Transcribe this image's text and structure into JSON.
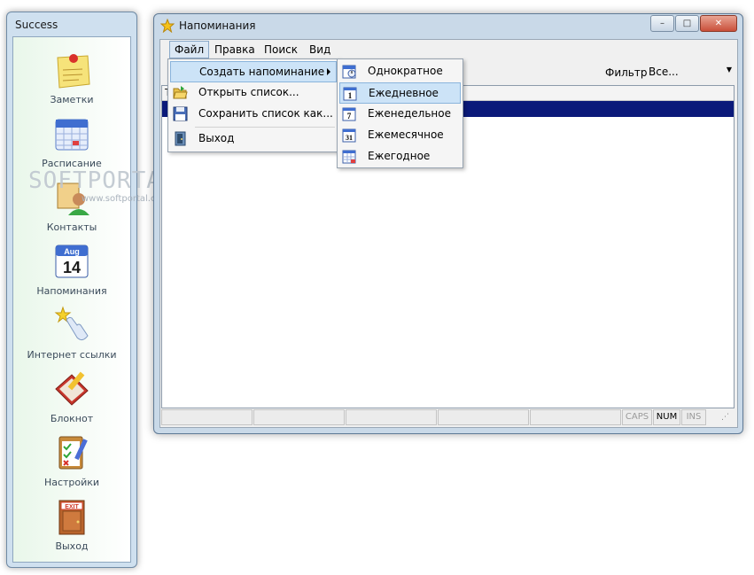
{
  "launcher": {
    "title": "Success",
    "items": [
      {
        "label": "Заметки",
        "icon": "sticky-note-icon"
      },
      {
        "label": "Расписание",
        "icon": "calendar-grid-icon"
      },
      {
        "label": "Контакты",
        "icon": "contacts-icon"
      },
      {
        "label": "Напоминания",
        "icon": "calendar-aug-14-icon"
      },
      {
        "label": "Интернет ссылки",
        "icon": "pointing-hand-star-icon"
      },
      {
        "label": "Блокнот",
        "icon": "notebook-pencil-icon"
      },
      {
        "label": "Настройки",
        "icon": "checklist-pencil-icon"
      },
      {
        "label": "Выход",
        "icon": "exit-door-icon"
      }
    ],
    "calendar_icon_month": "Aug",
    "calendar_icon_day": "14",
    "exit_icon_text": "EXIT"
  },
  "main_window": {
    "title": "Напоминания",
    "menu": [
      "Файл",
      "Правка",
      "Поиск",
      "Вид"
    ],
    "filter_label": "Фильтр",
    "filter_value": "Все...",
    "list_header_first": "Т"
  },
  "file_menu": {
    "items": [
      {
        "label": "Создать напоминание",
        "icon": "",
        "submenu": true
      },
      {
        "label": "Открыть список...",
        "icon": "open-folder-icon"
      },
      {
        "label": "Сохранить список как...",
        "icon": "floppy-disk-icon"
      },
      {
        "label": "Выход",
        "icon": "exit-door-icon"
      }
    ]
  },
  "create_submenu": {
    "items": [
      {
        "label": "Однократное",
        "icon": "calendar-once-icon",
        "glyph": ""
      },
      {
        "label": "Ежедневное",
        "icon": "calendar-daily-icon",
        "glyph": "1"
      },
      {
        "label": "Еженедельное",
        "icon": "calendar-weekly-icon",
        "glyph": "7"
      },
      {
        "label": "Ежемесячное",
        "icon": "calendar-monthly-icon",
        "glyph": "31"
      },
      {
        "label": "Ежегодное",
        "icon": "calendar-yearly-icon",
        "glyph": ""
      }
    ]
  },
  "status_bar": {
    "caps": "CAPS",
    "num": "NUM",
    "ins": "INS"
  },
  "watermark": {
    "text": "SOFTPORTAL",
    "sub": "www.softportal.com"
  },
  "colors": {
    "selection": "#0b1a7a",
    "menu_highlight": "#cce3f7",
    "launcher_bg": "#cfe0ef"
  }
}
